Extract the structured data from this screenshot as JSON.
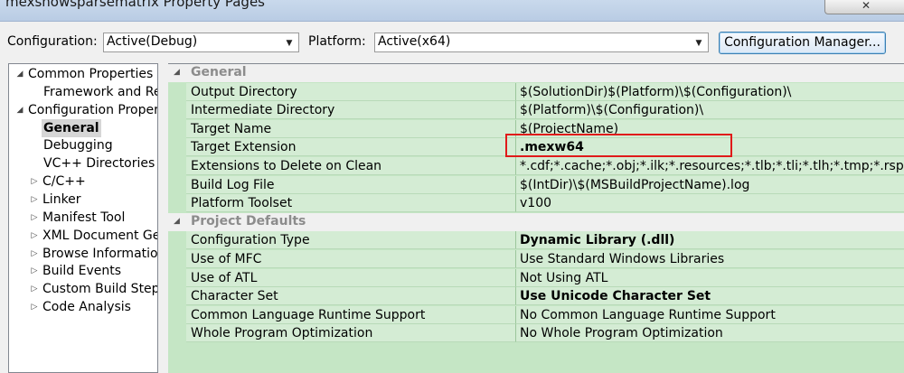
{
  "window": {
    "title": "mexshowsparsematrix Property Pages"
  },
  "config": {
    "configuration_label": "Configuration:",
    "configuration_value": "Active(Debug)",
    "platform_label": "Platform:",
    "platform_value": "Active(x64)",
    "manager_button": "Configuration Manager..."
  },
  "tree": [
    {
      "label": "Common Properties",
      "expander": "◢"
    },
    {
      "label": "Framework and References"
    },
    {
      "label": "Configuration Properties",
      "expander": "◢"
    },
    {
      "label": "General",
      "selected": true
    },
    {
      "label": "Debugging"
    },
    {
      "label": "VC++ Directories"
    },
    {
      "label": "C/C++",
      "expander": "▷"
    },
    {
      "label": "Linker",
      "expander": "▷"
    },
    {
      "label": "Manifest Tool",
      "expander": "▷"
    },
    {
      "label": "XML Document Generator",
      "expander": "▷"
    },
    {
      "label": "Browse Information",
      "expander": "▷"
    },
    {
      "label": "Build Events",
      "expander": "▷"
    },
    {
      "label": "Custom Build Step",
      "expander": "▷"
    },
    {
      "label": "Code Analysis",
      "expander": "▷"
    }
  ],
  "grid": {
    "categories": [
      {
        "name": "General",
        "properties": [
          {
            "name": "Output Directory",
            "value": "$(SolutionDir)$(Platform)\\$(Configuration)\\"
          },
          {
            "name": "Intermediate Directory",
            "value": "$(Platform)\\$(Configuration)\\"
          },
          {
            "name": "Target Name",
            "value": "$(ProjectName)"
          },
          {
            "name": "Target Extension",
            "value": ".mexw64",
            "bold": true
          },
          {
            "name": "Extensions to Delete on Clean",
            "value": "*.cdf;*.cache;*.obj;*.ilk;*.resources;*.tlb;*.tli;*.tlh;*.tmp;*.rsp;*.p"
          },
          {
            "name": "Build Log File",
            "value": "$(IntDir)\\$(MSBuildProjectName).log"
          },
          {
            "name": "Platform Toolset",
            "value": "v100"
          }
        ]
      },
      {
        "name": "Project Defaults",
        "properties": [
          {
            "name": "Configuration Type",
            "value": "Dynamic Library (.dll)",
            "bold": true
          },
          {
            "name": "Use of MFC",
            "value": "Use Standard Windows Libraries"
          },
          {
            "name": "Use of ATL",
            "value": "Not Using ATL"
          },
          {
            "name": "Character Set",
            "value": "Use Unicode Character Set",
            "bold": true
          },
          {
            "name": "Common Language Runtime Support",
            "value": "No Common Language Runtime Support"
          },
          {
            "name": "Whole Program Optimization",
            "value": "No Whole Program Optimization"
          }
        ]
      }
    ]
  },
  "colors": {
    "grid_background": "#c5e6c5",
    "highlight": "#e01a1a"
  }
}
